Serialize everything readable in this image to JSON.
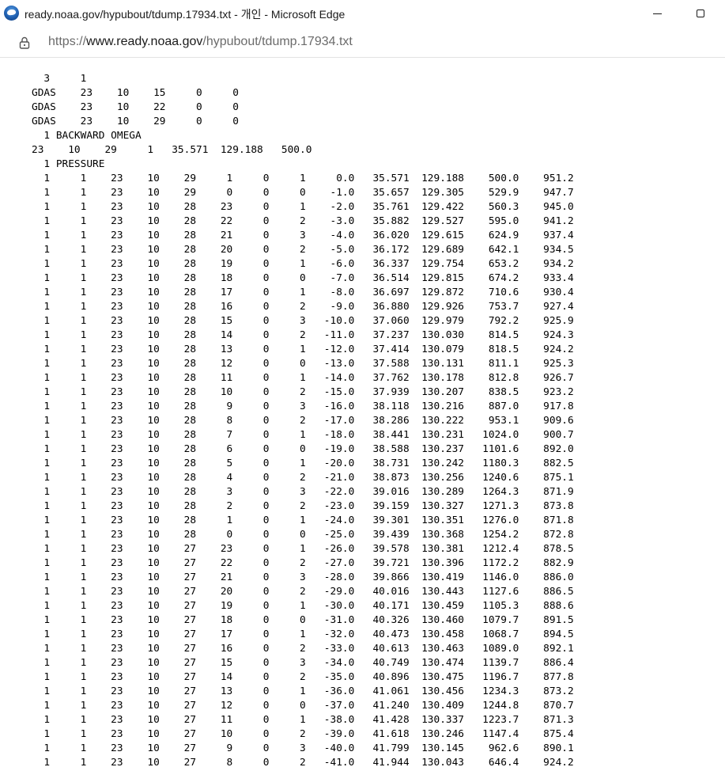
{
  "window": {
    "title": "ready.noaa.gov/hypubout/tdump.17934.txt - 개인 - Microsoft Edge",
    "favicon": "noaa-logo-icon"
  },
  "address_bar": {
    "scheme": "https://",
    "host": "www.ready.noaa.gov",
    "path": "/hypubout/tdump.17934.txt"
  },
  "document": {
    "lines": [
      "  3     1",
      "GDAS    23    10    15     0     0",
      "GDAS    23    10    22     0     0",
      "GDAS    23    10    29     0     0",
      "  1 BACKWARD OMEGA",
      "23    10    29     1   35.571  129.188   500.0",
      "  1 PRESSURE",
      "  1     1    23    10    29     1     0     1     0.0   35.571  129.188    500.0    951.2",
      "  1     1    23    10    29     0     0     0    -1.0   35.657  129.305    529.9    947.7",
      "  1     1    23    10    28    23     0     1    -2.0   35.761  129.422    560.3    945.0",
      "  1     1    23    10    28    22     0     2    -3.0   35.882  129.527    595.0    941.2",
      "  1     1    23    10    28    21     0     3    -4.0   36.020  129.615    624.9    937.4",
      "  1     1    23    10    28    20     0     2    -5.0   36.172  129.689    642.1    934.5",
      "  1     1    23    10    28    19     0     1    -6.0   36.337  129.754    653.2    934.2",
      "  1     1    23    10    28    18     0     0    -7.0   36.514  129.815    674.2    933.4",
      "  1     1    23    10    28    17     0     1    -8.0   36.697  129.872    710.6    930.4",
      "  1     1    23    10    28    16     0     2    -9.0   36.880  129.926    753.7    927.4",
      "  1     1    23    10    28    15     0     3   -10.0   37.060  129.979    792.2    925.9",
      "  1     1    23    10    28    14     0     2   -11.0   37.237  130.030    814.5    924.3",
      "  1     1    23    10    28    13     0     1   -12.0   37.414  130.079    818.5    924.2",
      "  1     1    23    10    28    12     0     0   -13.0   37.588  130.131    811.1    925.3",
      "  1     1    23    10    28    11     0     1   -14.0   37.762  130.178    812.8    926.7",
      "  1     1    23    10    28    10     0     2   -15.0   37.939  130.207    838.5    923.2",
      "  1     1    23    10    28     9     0     3   -16.0   38.118  130.216    887.0    917.8",
      "  1     1    23    10    28     8     0     2   -17.0   38.286  130.222    953.1    909.6",
      "  1     1    23    10    28     7     0     1   -18.0   38.441  130.231   1024.0    900.7",
      "  1     1    23    10    28     6     0     0   -19.0   38.588  130.237   1101.6    892.0",
      "  1     1    23    10    28     5     0     1   -20.0   38.731  130.242   1180.3    882.5",
      "  1     1    23    10    28     4     0     2   -21.0   38.873  130.256   1240.6    875.1",
      "  1     1    23    10    28     3     0     3   -22.0   39.016  130.289   1264.3    871.9",
      "  1     1    23    10    28     2     0     2   -23.0   39.159  130.327   1271.3    873.8",
      "  1     1    23    10    28     1     0     1   -24.0   39.301  130.351   1276.0    871.8",
      "  1     1    23    10    28     0     0     0   -25.0   39.439  130.368   1254.2    872.8",
      "  1     1    23    10    27    23     0     1   -26.0   39.578  130.381   1212.4    878.5",
      "  1     1    23    10    27    22     0     2   -27.0   39.721  130.396   1172.2    882.9",
      "  1     1    23    10    27    21     0     3   -28.0   39.866  130.419   1146.0    886.0",
      "  1     1    23    10    27    20     0     2   -29.0   40.016  130.443   1127.6    886.5",
      "  1     1    23    10    27    19     0     1   -30.0   40.171  130.459   1105.3    888.6",
      "  1     1    23    10    27    18     0     0   -31.0   40.326  130.460   1079.7    891.5",
      "  1     1    23    10    27    17     0     1   -32.0   40.473  130.458   1068.7    894.5",
      "  1     1    23    10    27    16     0     2   -33.0   40.613  130.463   1089.0    892.1",
      "  1     1    23    10    27    15     0     3   -34.0   40.749  130.474   1139.7    886.4",
      "  1     1    23    10    27    14     0     2   -35.0   40.896  130.475   1196.7    877.8",
      "  1     1    23    10    27    13     0     1   -36.0   41.061  130.456   1234.3    873.2",
      "  1     1    23    10    27    12     0     0   -37.0   41.240  130.409   1244.8    870.7",
      "  1     1    23    10    27    11     0     1   -38.0   41.428  130.337   1223.7    871.3",
      "  1     1    23    10    27    10     0     2   -39.0   41.618  130.246   1147.4    875.4",
      "  1     1    23    10    27     9     0     3   -40.0   41.799  130.145    962.6    890.1",
      "  1     1    23    10    27     8     0     2   -41.0   41.944  130.043    646.4    924.2"
    ]
  }
}
